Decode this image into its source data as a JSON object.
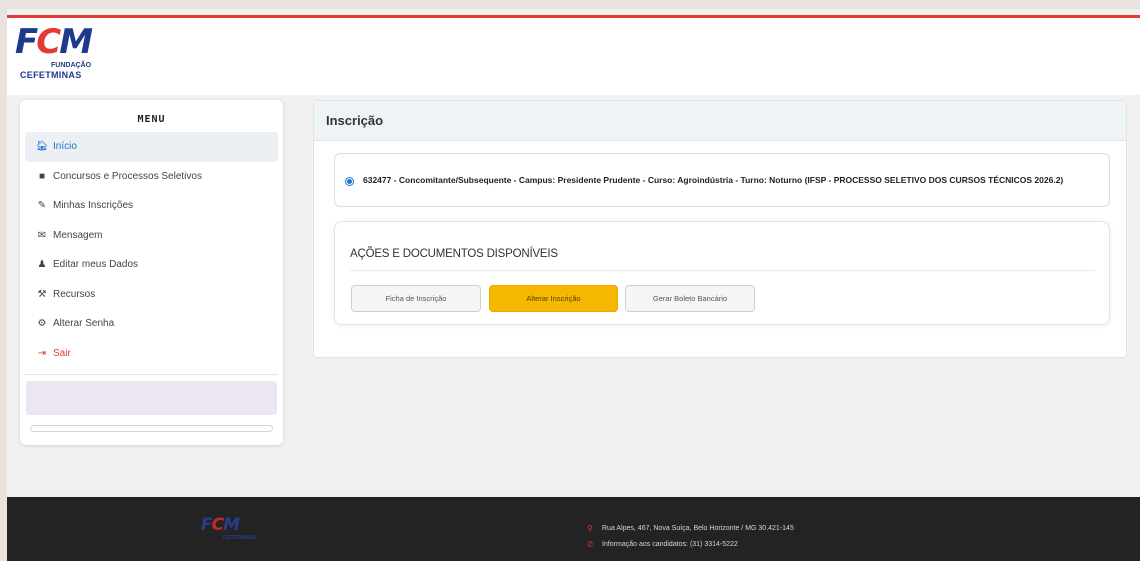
{
  "brand": {
    "logo_text": "FCM",
    "logo_sub1": "FUNDAÇÃO",
    "logo_sub2": "CEFETMINAS",
    "accent_red": "#e53935",
    "accent_blue": "#1976d2"
  },
  "sidebar": {
    "title": "MENU",
    "items": [
      {
        "label": "Início",
        "icon": "home-icon",
        "glyph": "🏠︎",
        "active": true
      },
      {
        "label": "Concursos e Processos Seletivos",
        "icon": "folder-icon",
        "glyph": "■"
      },
      {
        "label": "Minhas Inscrições",
        "icon": "edit-icon",
        "glyph": "✎"
      },
      {
        "label": "Mensagem",
        "icon": "envelope-icon",
        "glyph": "✉"
      },
      {
        "label": "Editar meus Dados",
        "icon": "user-icon",
        "glyph": "♟"
      },
      {
        "label": "Recursos",
        "icon": "gavel-icon",
        "glyph": "⚒"
      },
      {
        "label": "Alterar Senha",
        "icon": "gear-icon",
        "glyph": "⚙"
      },
      {
        "label": "Sair",
        "icon": "logout-icon",
        "glyph": "⇥"
      }
    ]
  },
  "main": {
    "title": "Inscrição",
    "inscription_text": "632477 - Concomitante/Subsequente - Campus: Presidente Prudente - Curso: Agroindústria - Turno: Noturno (IFSP - PROCESSO SELETIVO DOS CURSOS TÉCNICOS 2026.2)",
    "actions_title": "AÇÕES E DOCUMENTOS DISPONÍVEIS",
    "buttons": {
      "ficha": "Ficha de Inscrição",
      "alterar": "Alterar Inscrição",
      "boleto": "Gerar Boleto Bancário"
    }
  },
  "footer": {
    "logo_text": "FCM",
    "address": "Rua Alpes, 467, Nova Suíça, Belo Horizonte / MG 30.421-145",
    "phone": "Informação aos candidatos: (31) 3314-5222",
    "address_icon": "map-pin-icon",
    "phone_icon": "phone-icon"
  }
}
